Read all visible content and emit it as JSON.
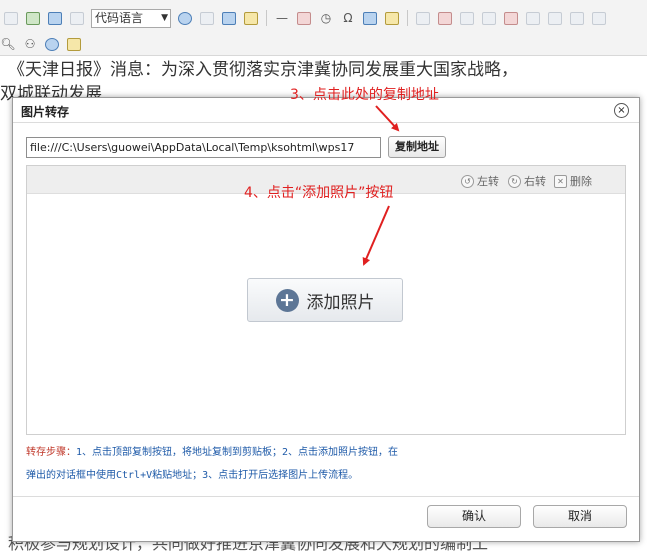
{
  "toolbar": {
    "code_language_label": "代码语言",
    "row1_icons": [
      "bold-style-icon",
      "image-icon",
      "gallery-icon",
      "code-icon"
    ],
    "row1_after_select_icons": [
      "emotion-icon",
      "insert-row-icon",
      "template-icon",
      "attachment-icon",
      "horizontal-rule-icon",
      "date-icon",
      "time-icon",
      "special-char-icon",
      "search-replace-icon",
      "image-transfer-icon",
      "table-icon",
      "delete-table-icon",
      "insert-row-table-icon",
      "insert-col-table-icon",
      "merge-cells-icon",
      "split-cells-icon",
      "split-rows-icon",
      "split-cols-icon"
    ],
    "row2_icons": [
      "preview-icon",
      "find-icon",
      "help-icon",
      "paste-icon"
    ],
    "omega_glyph": "Ω"
  },
  "editor": {
    "line1": "《天津日报》消息：为深入贯彻落实京津冀协同发展重大国家战略，",
    "line2": "双城联动发展",
    "bottom_line": "积极参与规划设计，共同做好推进京津冀协同发展和大规划的编制工"
  },
  "dialog": {
    "title": "图片转存",
    "close_glyph": "×",
    "path_value": "file:///C:\\Users\\guowei\\AppData\\Local\\Temp\\ksohtml\\wps17",
    "copy_button_label": "复制地址",
    "panel": {
      "rotate_left_label": "左转",
      "rotate_right_label": "右转",
      "delete_label": "删除",
      "add_photo_label": "添加照片",
      "plus_glyph": "+"
    },
    "steps_prefix": "转存步骤：",
    "steps_line1": "1、点击顶部复制按钮，将地址复制到剪贴板；2、点击添加照片按钮，在",
    "steps_line2": "弹出的对话框中使用Ctrl+V粘贴地址；3、点击打开后选择图片上传流程。",
    "ok_label": "确认",
    "cancel_label": "取消"
  },
  "annotations": {
    "step3": "3、点击此处的复制地址",
    "step4": "4、点击“添加照片”按钮",
    "color": "#e02020"
  },
  "colors": {
    "accent_blue": "#5d7696",
    "steps_text": "#1e5aa8",
    "steps_prefix": "#c0392b"
  }
}
